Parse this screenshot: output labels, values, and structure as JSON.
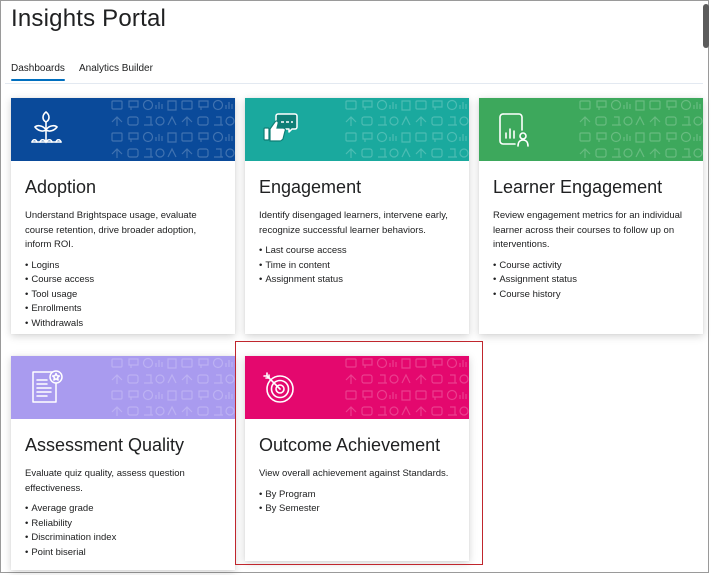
{
  "page": {
    "title": "Insights Portal"
  },
  "tabs": [
    {
      "label": "Dashboards",
      "active": true
    },
    {
      "label": "Analytics Builder",
      "active": false
    }
  ],
  "colors": {
    "tab_accent": "#006fbf",
    "highlight_border": "#c0262d"
  },
  "cards": [
    {
      "title": "Adoption",
      "description": "Understand Brightspace usage, evaluate course retention, drive broader adoption, inform ROI.",
      "items": [
        "Logins",
        "Course access",
        "Tool usage",
        "Enrollments",
        "Withdrawals"
      ],
      "banner_color": "#0a4a9a",
      "icon": "seedling-icon"
    },
    {
      "title": "Engagement",
      "description": "Identify disengaged learners, intervene early, recognize successful learner behaviors.",
      "items": [
        "Last course access",
        "Time in content",
        "Assignment status"
      ],
      "banner_color": "#1aa99e",
      "icon": "thumbs-up-chat-icon"
    },
    {
      "title": "Learner Engagement",
      "description": "Review engagement metrics for an individual learner across their courses to follow up on interventions.",
      "items": [
        "Course activity",
        "Assignment status",
        "Course history"
      ],
      "banner_color": "#3da85c",
      "icon": "learner-report-icon"
    },
    {
      "title": "Assessment Quality",
      "description": "Evaluate quiz quality, assess question effectiveness.",
      "items": [
        "Average grade",
        "Reliability",
        "Discrimination index",
        "Point biserial"
      ],
      "banner_color": "#a99bef",
      "icon": "quiz-document-icon"
    },
    {
      "title": "Outcome Achievement",
      "description": "View overall achievement against Standards.",
      "items": [
        "By Program",
        "By Semester"
      ],
      "banner_color": "#e4086e",
      "icon": "target-icon"
    }
  ]
}
